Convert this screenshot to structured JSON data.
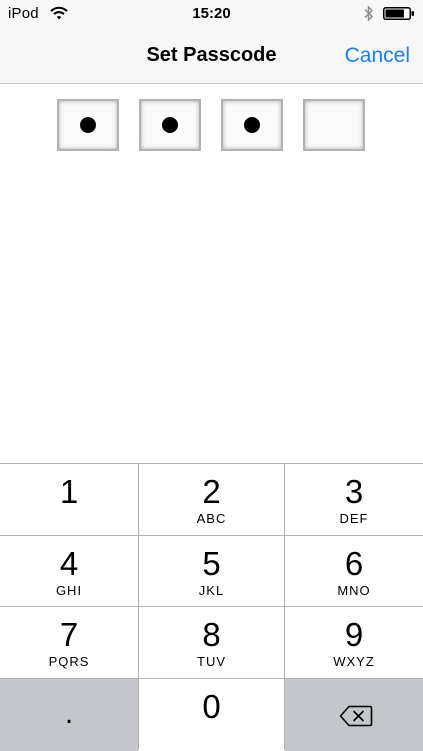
{
  "status_bar": {
    "carrier": "iPod",
    "time": "15:20",
    "wifi_icon": "wifi-icon",
    "bluetooth_icon": "bluetooth-icon",
    "battery_icon": "battery-icon",
    "battery_level": 0.8
  },
  "nav": {
    "title": "Set Passcode",
    "cancel_label": "Cancel",
    "accent_color": "#1a7ff8"
  },
  "passcode": {
    "length": 4,
    "filled": 3,
    "entry_indicator": "●"
  },
  "keypad": {
    "keys": [
      {
        "num": "1",
        "letters": ""
      },
      {
        "num": "2",
        "letters": "ABC"
      },
      {
        "num": "3",
        "letters": "DEF"
      },
      {
        "num": "4",
        "letters": "GHI"
      },
      {
        "num": "5",
        "letters": "JKL"
      },
      {
        "num": "6",
        "letters": "MNO"
      },
      {
        "num": "7",
        "letters": "PQRS"
      },
      {
        "num": "8",
        "letters": "TUV"
      },
      {
        "num": "9",
        "letters": "WXYZ"
      }
    ],
    "bottom": {
      "dot_label": ".",
      "zero_label": "0",
      "delete_icon": "delete-backspace-icon"
    }
  }
}
